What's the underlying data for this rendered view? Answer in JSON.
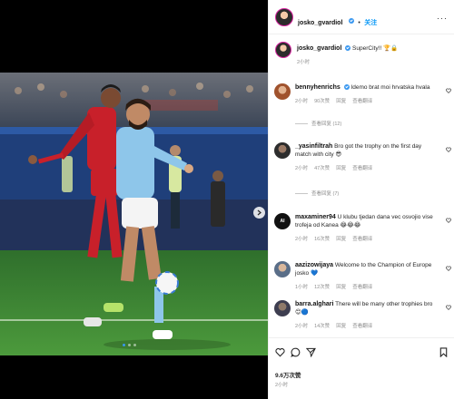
{
  "post": {
    "author": "josko_gvardiol",
    "follow_label": "关注",
    "caption_text": "SuperCity!! 🏆🔒",
    "caption_time": "2小时",
    "likes": "9.6万次赞",
    "post_time": "2小时"
  },
  "carousel": {
    "dot_count": 3,
    "active_index": 0
  },
  "labels": {
    "reply": "回复",
    "translate": "查看翻译"
  },
  "comments": [
    {
      "user": "bennyhenrichs",
      "verified": true,
      "text": "Idemo brat moi hrvatska hvala",
      "time": "2小时",
      "likes": "90次赞",
      "replies": "查看回复 (12)"
    },
    {
      "user": "_yasinfiltrah",
      "verified": false,
      "text": "Bro got the trophy on the first day match with city 😎",
      "time": "2小时",
      "likes": "47次赞",
      "replies": "查看回复 (7)"
    },
    {
      "user": "maxaminer94",
      "verified": false,
      "text": "U klubu tjedan dana vec osvojio vise trofeja od Kanea 😂😂😂",
      "time": "2小时",
      "likes": "16次赞",
      "replies": ""
    },
    {
      "user": "aazizowijaya",
      "verified": false,
      "text": "Welcome to the Champion of Europe josko 💙",
      "time": "1小时",
      "likes": "12次赞",
      "replies": ""
    },
    {
      "user": "barra.alghari",
      "verified": false,
      "text": "There will be many other trophies bro 😊🔵",
      "time": "2小时",
      "likes": "14次赞",
      "replies": ""
    }
  ],
  "colors": {
    "link_blue": "#0095f6",
    "verified_blue": "#3897f0",
    "secondary_text": "#8e8e8e",
    "pitch_green": "#3f8a34",
    "sevilla_red": "#c8202a",
    "city_sky": "#8ec6ea"
  },
  "icons": [
    "heart-icon",
    "comment-icon",
    "share-icon",
    "bookmark-icon",
    "more-icon",
    "chevron-right-icon",
    "verified-icon"
  ]
}
